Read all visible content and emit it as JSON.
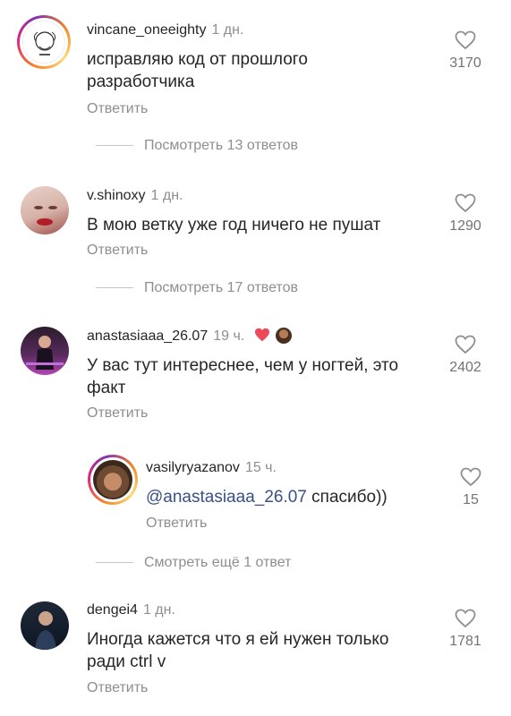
{
  "comments": [
    {
      "username": "vincane_oneeighty",
      "time": "1 дн.",
      "text": "исправляю код от прошлого разработчика",
      "reply_label": "Ответить",
      "likes": "3170",
      "view_replies": "Посмотреть 13 ответов"
    },
    {
      "username": "v.shinoxy",
      "time": "1 дн.",
      "text": "В мою ветку уже год ничего не пушат",
      "reply_label": "Ответить",
      "likes": "1290",
      "view_replies": "Посмотреть 17 ответов"
    },
    {
      "username": "anastasiaaa_26.07",
      "time": "19 ч.",
      "text": "У вас тут интереснее, чем у ногтей, это факт",
      "reply_label": "Ответить",
      "likes": "2402"
    },
    {
      "username": "vasilyryazanov",
      "time": "15 ч.",
      "mention": "@anastasiaaa_26.07",
      "text": " спасибо))",
      "reply_label": "Ответить",
      "likes": "15",
      "view_replies": "Смотреть ещё 1 ответ"
    },
    {
      "username": "dengei4",
      "time": "1 дн.",
      "text": "Иногда кажется что я ей нужен только ради ctrl v",
      "reply_label": "Ответить",
      "likes": "1781"
    }
  ],
  "colors": {
    "text": "#262626",
    "secondary": "#8e8e8e",
    "mention": "#385185",
    "heart_red": "#ed4956"
  }
}
